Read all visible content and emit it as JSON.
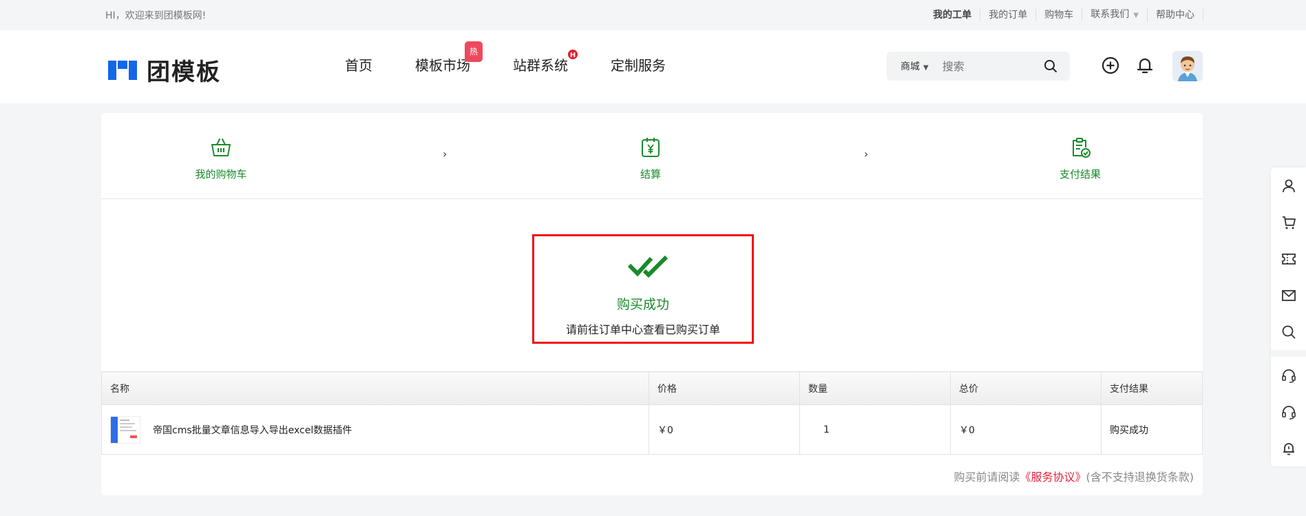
{
  "topbar": {
    "welcome": "HI，欢迎来到团模板网!",
    "links": [
      "我的工单",
      "我的订单",
      "购物车",
      "联系我们",
      "帮助中心"
    ]
  },
  "header": {
    "logo_text": "团模板",
    "nav": [
      {
        "label": "首页"
      },
      {
        "label": "模板市场",
        "badge": "热"
      },
      {
        "label": "站群系统",
        "badge": "H"
      },
      {
        "label": "定制服务"
      }
    ],
    "search": {
      "scope": "商城",
      "placeholder": "搜索"
    },
    "colors": {
      "brand": "#1267e8",
      "hot_badge": "#ef4a5c",
      "accent_green": "#1a8a2b"
    }
  },
  "steps": [
    {
      "label": "我的购物车",
      "icon": "basket-icon"
    },
    {
      "label": "结算",
      "icon": "yen-calendar-icon"
    },
    {
      "label": "支付结果",
      "icon": "clipboard-check-icon"
    }
  ],
  "result": {
    "title": "购买成功",
    "subtitle": "请前往订单中心查看已购买订单"
  },
  "table": {
    "headers": [
      "名称",
      "价格",
      "数量",
      "总价",
      "支付结果"
    ],
    "rows": [
      {
        "name": "帝国cms批量文章信息导入导出excel数据插件",
        "price": "￥0",
        "qty": "1",
        "total": "￥0",
        "status": "购买成功"
      }
    ]
  },
  "agreement": {
    "prefix": "购买前请阅读",
    "link": "《服务协议》",
    "suffix": "(含不支持退换货条款)"
  },
  "sidebar": [
    "user-icon",
    "cart-icon",
    "ticket-icon",
    "mail-icon",
    "search-icon",
    "headset-icon",
    "headset-icon",
    "bell-icon"
  ]
}
